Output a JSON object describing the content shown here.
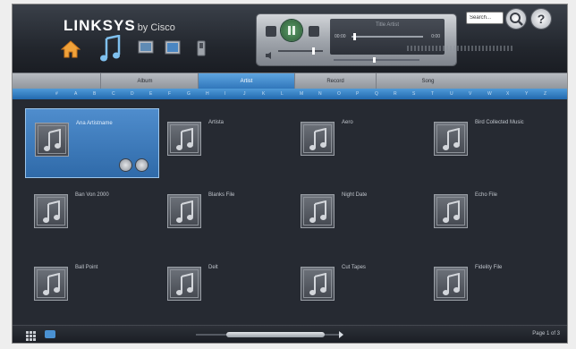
{
  "header": {
    "brand": "LINKSYS",
    "brand_suffix": "by Cisco",
    "nav_icons": [
      "home-icon",
      "music-icon",
      "photo-icon",
      "video-icon",
      "device-icon"
    ]
  },
  "player": {
    "track_title": "Title Artist",
    "elapsed": "00:00",
    "total": "0:00",
    "state": "paused"
  },
  "search": {
    "value": "Search..."
  },
  "help": {
    "label": "?"
  },
  "tabs": [
    {
      "label": "Album",
      "active": false
    },
    {
      "label": "Artist",
      "active": true
    },
    {
      "label": "Record",
      "active": false
    },
    {
      "label": "Song",
      "active": false
    }
  ],
  "alphabet": [
    "#",
    "A",
    "B",
    "C",
    "D",
    "E",
    "F",
    "G",
    "H",
    "I",
    "J",
    "K",
    "L",
    "M",
    "N",
    "O",
    "P",
    "Q",
    "R",
    "S",
    "T",
    "U",
    "V",
    "W",
    "X",
    "Y",
    "Z"
  ],
  "artists": [
    {
      "name": "Ana Artistname",
      "selected": true
    },
    {
      "name": "Artista",
      "selected": false
    },
    {
      "name": "Aero",
      "selected": false
    },
    {
      "name": "Bird Collected Music",
      "selected": false
    },
    {
      "name": "Ban Von 2000",
      "selected": false
    },
    {
      "name": "Blanks File",
      "selected": false
    },
    {
      "name": "Night Date",
      "selected": false
    },
    {
      "name": "Echo File",
      "selected": false
    },
    {
      "name": "Ball Point",
      "selected": false
    },
    {
      "name": "Delt",
      "selected": false
    },
    {
      "name": "Cut Tapes",
      "selected": false
    },
    {
      "name": "Fidelity File",
      "selected": false
    }
  ],
  "footer": {
    "page_indicator": "Page 1 of 3"
  },
  "colors": {
    "accent": "#2f74b9",
    "selected_cell": "#3f7ebf",
    "background": "#262a32"
  }
}
